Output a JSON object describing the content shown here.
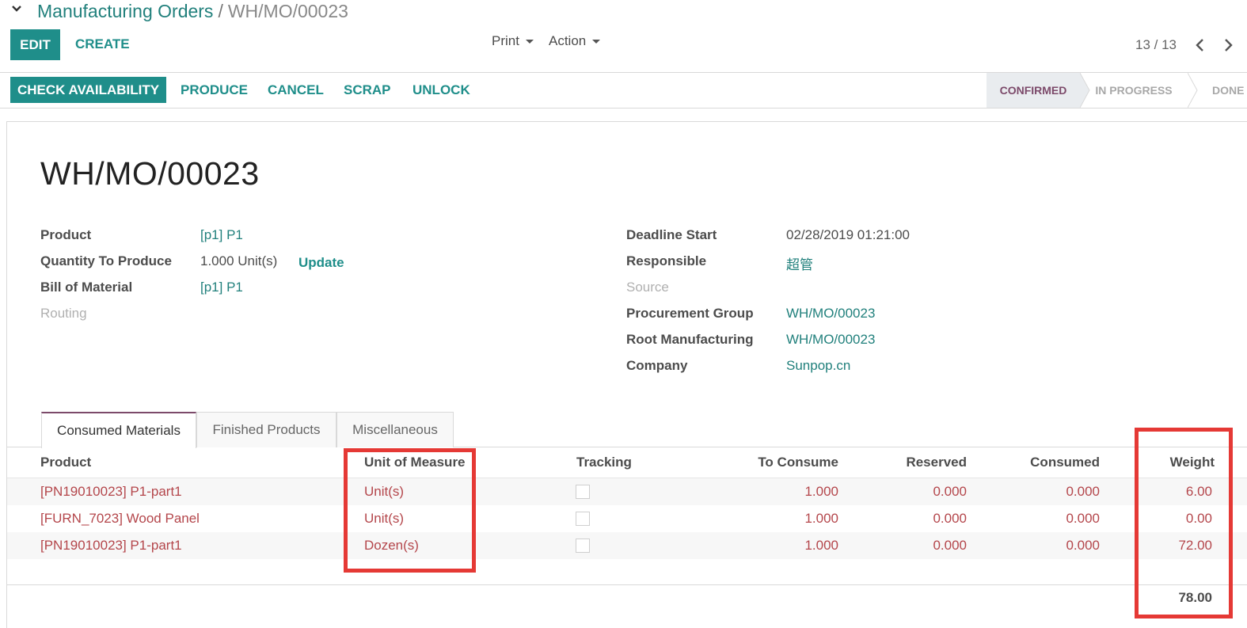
{
  "breadcrumb": {
    "parent": "Manufacturing Orders",
    "separator": "/",
    "current": "WH/MO/00023"
  },
  "toolbar": {
    "edit": "EDIT",
    "create": "CREATE",
    "print": "Print",
    "action": "Action"
  },
  "pager": {
    "value": "13 / 13"
  },
  "statusbar": {
    "buttons": [
      "CHECK AVAILABILITY",
      "PRODUCE",
      "CANCEL",
      "SCRAP",
      "UNLOCK"
    ],
    "stages": [
      "CONFIRMED",
      "IN PROGRESS",
      "DONE"
    ],
    "active_stage": "CONFIRMED"
  },
  "record": {
    "title": "WH/MO/00023",
    "left": {
      "product_label": "Product",
      "product_value": "[p1] P1",
      "qty_label": "Quantity To Produce",
      "qty_value": "1.000 Unit(s)",
      "update": "Update",
      "bom_label": "Bill of Material",
      "bom_value": "[p1] P1",
      "routing_label": "Routing"
    },
    "right": {
      "deadline_label": "Deadline Start",
      "deadline_value": "02/28/2019 01:21:00",
      "responsible_label": "Responsible",
      "responsible_value": "超管",
      "source_label": "Source",
      "pg_label": "Procurement Group",
      "pg_value": "WH/MO/00023",
      "root_label": "Root Manufacturing",
      "root_value": "WH/MO/00023",
      "company_label": "Company",
      "company_value": "Sunpop.cn"
    }
  },
  "tabs": [
    "Consumed Materials",
    "Finished Products",
    "Miscellaneous"
  ],
  "table": {
    "headers": [
      "Product",
      "Unit of Measure",
      "Tracking",
      "To Consume",
      "Reserved",
      "Consumed",
      "Weight"
    ],
    "rows": [
      {
        "product": "[PN19010023] P1-part1",
        "uom": "Unit(s)",
        "to_consume": "1.000",
        "reserved": "0.000",
        "consumed": "0.000",
        "weight": "6.00"
      },
      {
        "product": "[FURN_7023] Wood Panel",
        "uom": "Unit(s)",
        "to_consume": "1.000",
        "reserved": "0.000",
        "consumed": "0.000",
        "weight": "0.00"
      },
      {
        "product": "[PN19010023] P1-part1",
        "uom": "Dozen(s)",
        "to_consume": "1.000",
        "reserved": "0.000",
        "consumed": "0.000",
        "weight": "72.00"
      }
    ],
    "total_weight": "78.00"
  },
  "colors": {
    "primary": "#1f8e8a",
    "accent": "#7c4a6a",
    "row_text": "#b4464b",
    "highlight": "#e53935"
  }
}
